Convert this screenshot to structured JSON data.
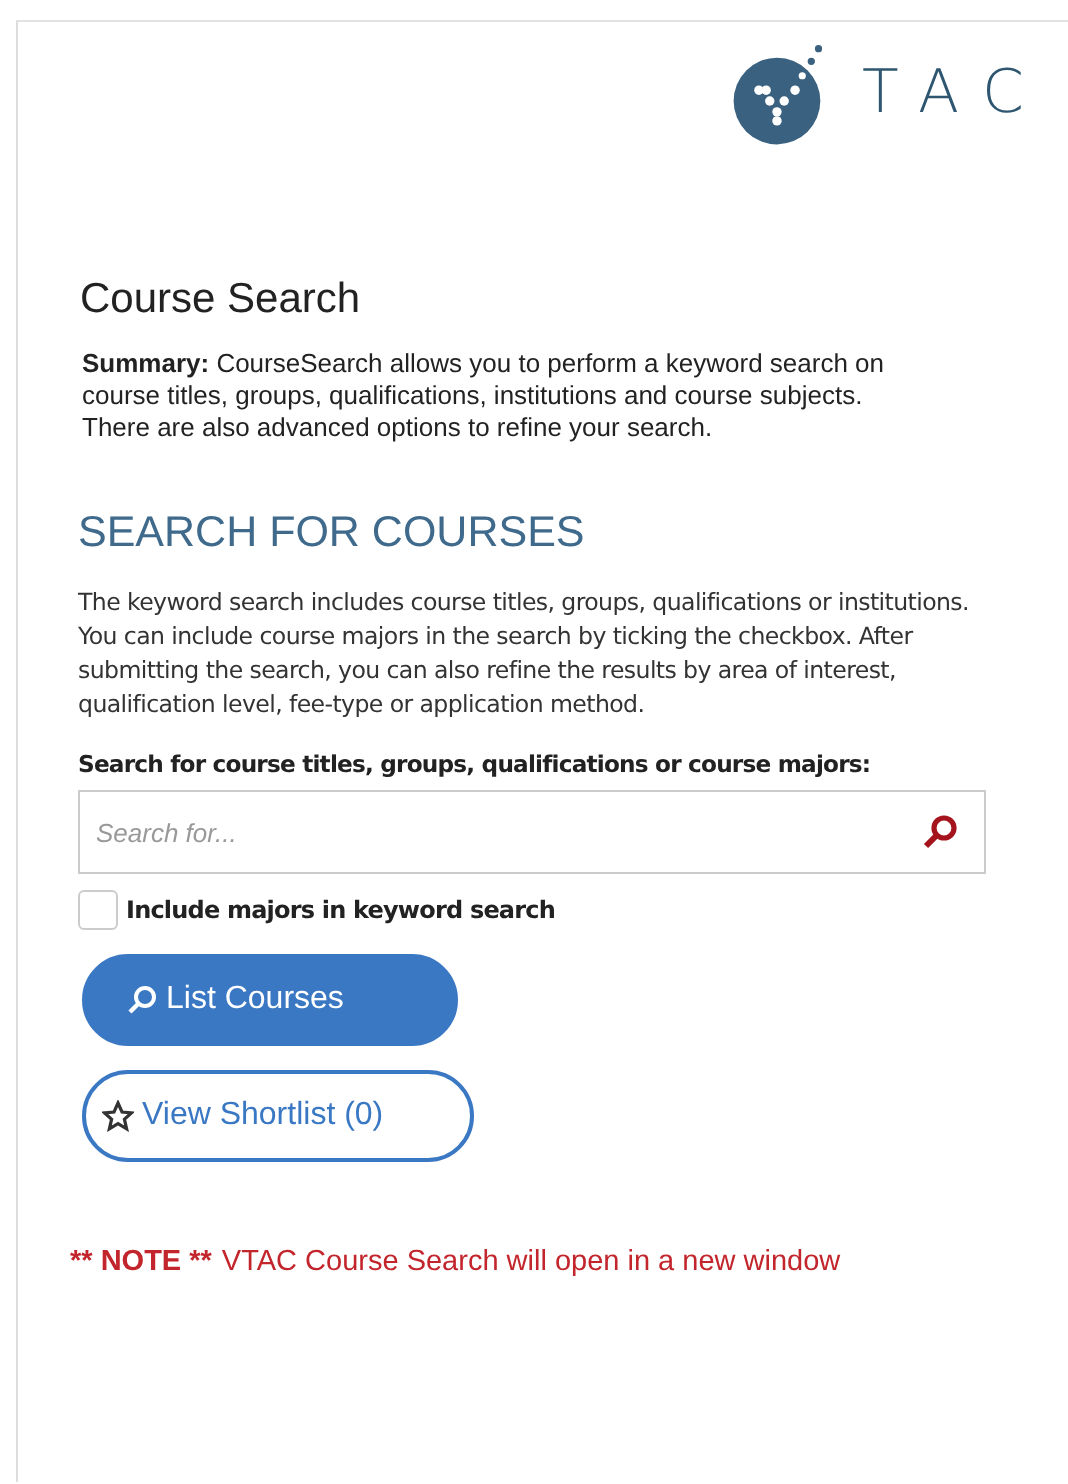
{
  "logo": {
    "text": "TAC"
  },
  "title": "Course Search",
  "summary": "**Summary:** CourseSearch allows you to perform a keyword search on course titles, groups, qualifications, institutions and course subjects. There are also advanced options to refine your search.",
  "section_heading": "SEARCH FOR COURSES",
  "description": "The keyword search includes course titles, groups, qualifications or institutions. You can include course majors in the search by ticking the checkbox. After submitting the search, you can also refine the results by area of interest, qualification level, fee-type or application method.",
  "search": {
    "label": "Search for course titles, groups, qualifications or course majors:",
    "placeholder": "Search for..."
  },
  "include_majors": {
    "label": "Include majors in keyword search",
    "checked": false
  },
  "buttons": [
    {
      "kind": "primary",
      "label": "List Courses"
    },
    {
      "kind": "outline",
      "label": "View Shortlist (0)"
    }
  ],
  "note": {
    "label": "** NOTE **",
    "text": "VTAC Course Search will open in a new window"
  }
}
